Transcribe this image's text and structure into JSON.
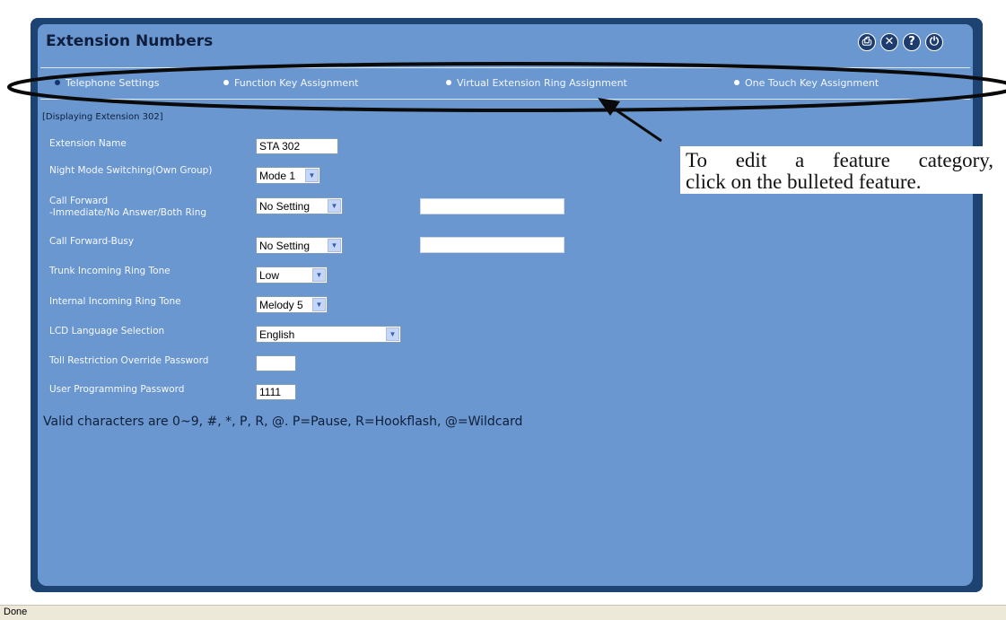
{
  "page": {
    "title": "Extension Numbers",
    "title_icons": [
      "print-icon",
      "close-icon",
      "help-icon",
      "logout-icon"
    ],
    "icon_glyphs": {
      "print": "⎙",
      "close": "✕",
      "help": "?",
      "logout": "⏻"
    }
  },
  "tabs": [
    {
      "label": "Telephone Settings",
      "active": true
    },
    {
      "label": "Function Key Assignment",
      "active": false
    },
    {
      "label": "Virtual Extension Ring Assignment",
      "active": false
    },
    {
      "label": "One Touch Key Assignment",
      "active": false
    }
  ],
  "displaying": "[Displaying Extension 302]",
  "form": {
    "extension_name": {
      "label": "Extension Name",
      "value": "STA 302"
    },
    "night_mode": {
      "label": "Night Mode Switching(Own Group)",
      "value": "Mode 1"
    },
    "call_forward_immediate": {
      "label_line1": "Call Forward",
      "label_line2": "-Immediate/No Answer/Both Ring",
      "value": "No Setting",
      "number": ""
    },
    "call_forward_busy": {
      "label": "Call Forward-Busy",
      "value": "No Setting",
      "number": ""
    },
    "trunk_ring_tone": {
      "label": "Trunk Incoming Ring Tone",
      "value": "Low"
    },
    "internal_ring_tone": {
      "label": "Internal Incoming Ring Tone",
      "value": "Melody 5"
    },
    "lcd_language": {
      "label": "LCD Language Selection",
      "value": "English"
    },
    "toll_password": {
      "label": "Toll Restriction Override Password",
      "value": ""
    },
    "user_password": {
      "label": "User Programming Password",
      "value": "1111"
    }
  },
  "valid_chars": "Valid characters are 0~9, #, *, P, R, @. P=Pause, R=Hookflash, @=Wildcard",
  "callout": {
    "line1": "To edit a feature category,",
    "line2": "click on the bulleted feature."
  },
  "status": "Done",
  "colors": {
    "frame": "#1d4372",
    "panel": "#6a97cf",
    "title": "#0e1e3c"
  }
}
